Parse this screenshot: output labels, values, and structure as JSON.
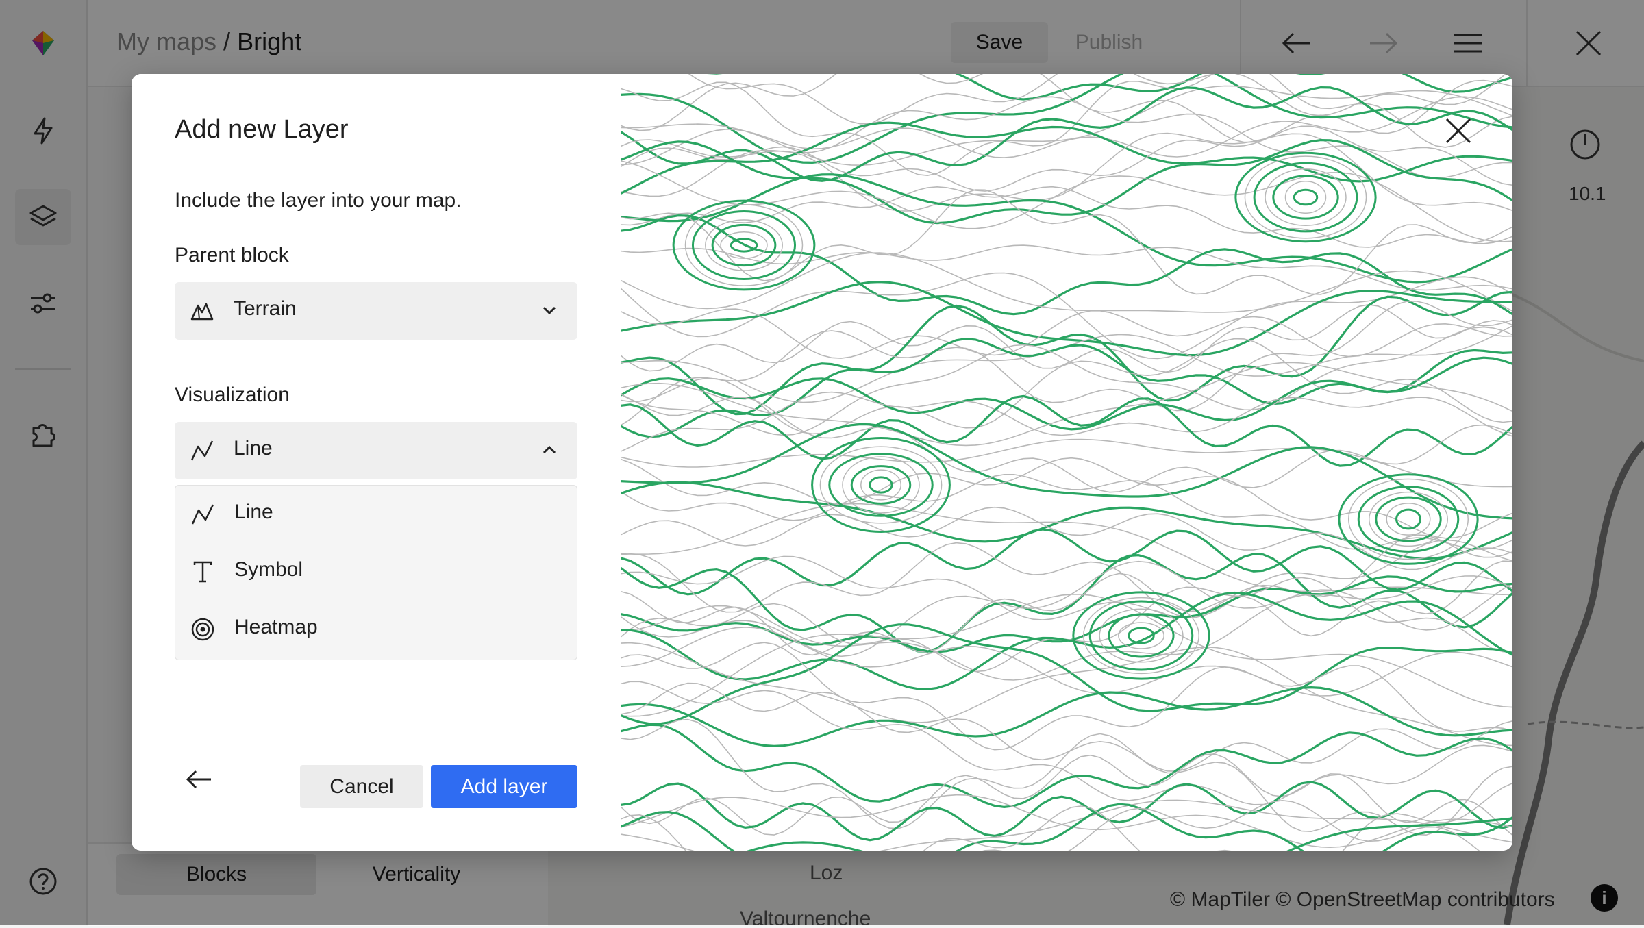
{
  "breadcrumb": {
    "parent": "My maps",
    "separator": "/",
    "current": "Bright"
  },
  "toolbar": {
    "save_label": "Save",
    "publish_label": "Publish"
  },
  "side_nav": {
    "icons": [
      "logo-icon",
      "bolt-icon",
      "layers-icon",
      "sliders-icon",
      "puzzle-icon",
      "help-icon"
    ]
  },
  "right_panel": {
    "zoom_label": "10.1"
  },
  "bottom_tabs": {
    "blocks": "Blocks",
    "verticality": "Verticality"
  },
  "map": {
    "attribution": "© MapTiler © OpenStreetMap contributors",
    "places": [
      "Loz",
      "Valtournenche"
    ]
  },
  "modal": {
    "title": "Add new Layer",
    "description": "Include the layer into your map.",
    "parent_block_label": "Parent block",
    "parent_block_value": "Terrain",
    "visualization_label": "Visualization",
    "visualization_value": "Line",
    "visualization_options": [
      {
        "label": "Line",
        "icon": "line-chart-icon"
      },
      {
        "label": "Symbol",
        "icon": "text-symbol-icon"
      },
      {
        "label": "Heatmap",
        "icon": "heatmap-icon"
      }
    ],
    "cancel_label": "Cancel",
    "add_label": "Add layer"
  },
  "colors": {
    "accent": "#2f6cf2",
    "contour_major": "#2aa562",
    "contour_minor": "#b8b8b8"
  }
}
